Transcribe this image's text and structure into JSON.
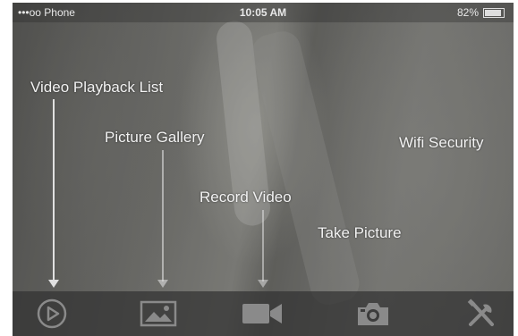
{
  "status_bar": {
    "carrier": "•••oo Phone",
    "time": "10:05 AM",
    "battery": "82%",
    "battery_level": 0.82
  },
  "annotations": {
    "video_playback_list": "Video Playback List",
    "picture_gallery": "Picture Gallery",
    "record_video": "Record Video",
    "take_picture": "Take Picture",
    "wifi_security": "Wifi Security"
  },
  "toolbar": {
    "icons": [
      "play-icon",
      "gallery-icon",
      "video-camera-icon",
      "camera-icon",
      "tools-icon"
    ]
  },
  "colors": {
    "label_text": "#f2f2f2",
    "toolbar_bg": "#323232"
  }
}
